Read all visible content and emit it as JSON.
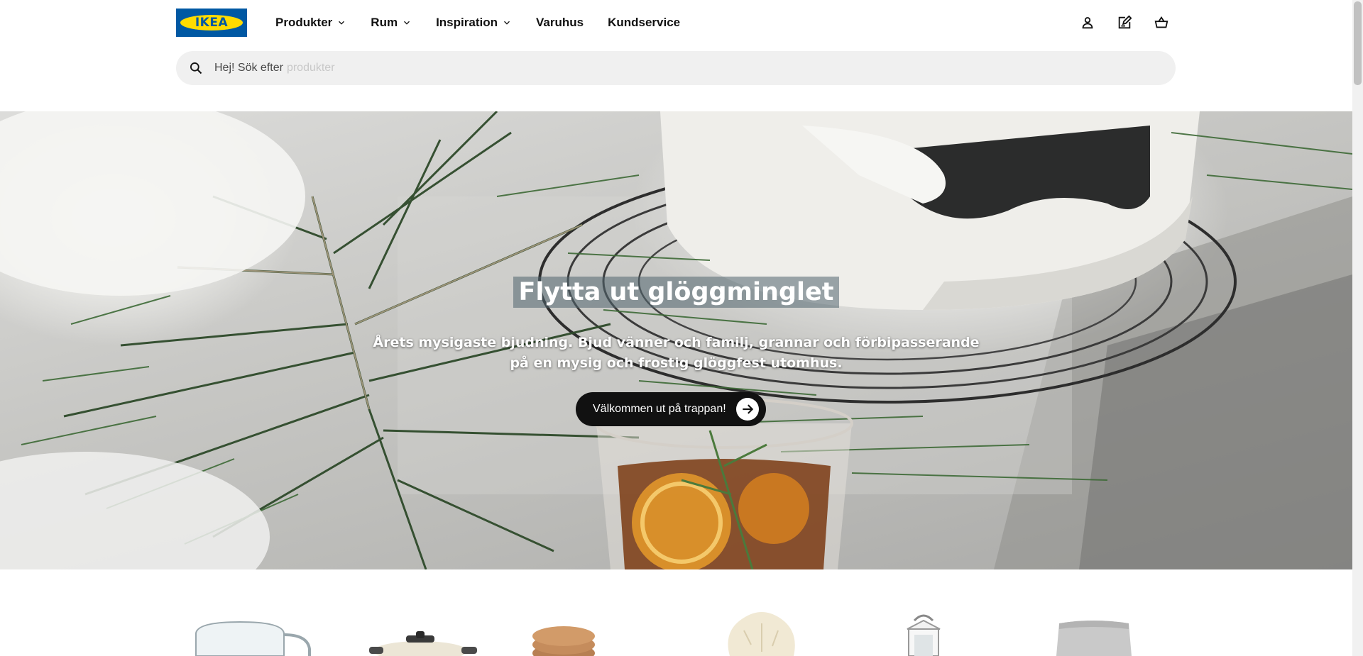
{
  "brand": {
    "logo_text": "IKEA",
    "primary_color": "#0058a3",
    "accent_color": "#ffdb00"
  },
  "nav": {
    "items": [
      {
        "label": "Produkter",
        "has_dropdown": true
      },
      {
        "label": "Rum",
        "has_dropdown": true
      },
      {
        "label": "Inspiration",
        "has_dropdown": true
      },
      {
        "label": "Varuhus",
        "has_dropdown": false
      },
      {
        "label": "Kundservice",
        "has_dropdown": false
      }
    ]
  },
  "header_icons": [
    {
      "name": "user-icon"
    },
    {
      "name": "shopping-list-icon"
    },
    {
      "name": "cart-icon"
    }
  ],
  "search": {
    "label": "Hej! Sök efter",
    "placeholder": "produkter"
  },
  "hero": {
    "title": "Flytta ut glöggminglet",
    "description": "Årets mysigaste bjudning. Bjud vänner och familj, grannar och förbipasserande på en mysig och frostig glöggfest utomhus.",
    "cta_label": "Välkommen ut på trappan!"
  },
  "products": [
    {
      "name": "glass-mug-image"
    },
    {
      "name": "pot-image"
    },
    {
      "name": "cork-coasters-image"
    },
    {
      "name": "sheepskin-image"
    },
    {
      "name": "lantern-image"
    },
    {
      "name": "throw-blanket-image"
    }
  ]
}
